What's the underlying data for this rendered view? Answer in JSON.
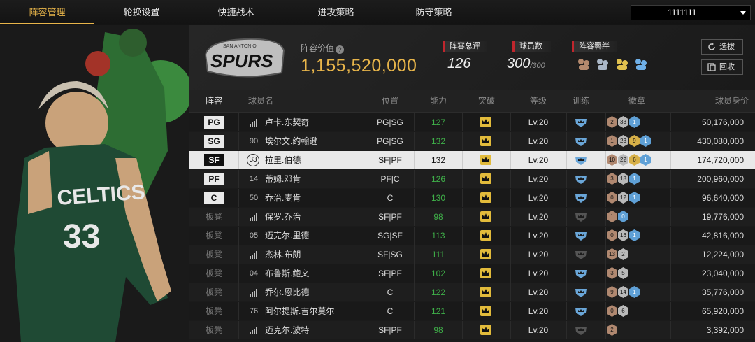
{
  "nav": {
    "tabs": [
      "阵容管理",
      "轮换设置",
      "快捷战术",
      "进攻策略",
      "防守策略"
    ],
    "active_tab": 0,
    "user_select": "1111111"
  },
  "header": {
    "cap_label": "阵容价值",
    "cap_value": "1,155,520,000",
    "overall_label": "阵容总评",
    "overall_value": "126",
    "count_label": "球员数",
    "count_value": "300",
    "count_max": "/300",
    "bond_label": "阵容羁绊",
    "logo_text": "SPURS",
    "logo_city": "SAN ANTONIO",
    "btn_select": "选拔",
    "btn_recycle": "回收"
  },
  "columns": [
    "阵容",
    "球员名",
    "位置",
    "能力",
    "突破",
    "等级",
    "训练",
    "徽章",
    "球员身价"
  ],
  "rows": [
    {
      "slot": "PG",
      "starter": true,
      "num": "",
      "name": "卢卡.东契奇",
      "pos": "PG|SG",
      "ability": "127",
      "level": "Lv.20",
      "train": "blue",
      "badges": [
        [
          "b-br",
          "2"
        ],
        [
          "b-si",
          "33"
        ],
        [
          "b-hf",
          "1"
        ]
      ],
      "value": "50,176,000"
    },
    {
      "slot": "SG",
      "starter": true,
      "num": "90",
      "name": "埃尔文.约翰逊",
      "pos": "PG|SG",
      "ability": "132",
      "level": "Lv.20",
      "train": "blue",
      "badges": [
        [
          "b-br",
          "1"
        ],
        [
          "b-si",
          "23"
        ],
        [
          "b-go",
          "9"
        ],
        [
          "b-hf",
          "1"
        ]
      ],
      "value": "430,080,000"
    },
    {
      "slot": "SF",
      "starter": true,
      "num": "33",
      "name": "拉里.伯德",
      "pos": "SF|PF",
      "ability": "132",
      "level": "Lv.20",
      "train": "blue",
      "badges": [
        [
          "b-br",
          "10"
        ],
        [
          "b-si",
          "22"
        ],
        [
          "b-go",
          "6"
        ],
        [
          "b-hf",
          "1"
        ]
      ],
      "value": "174,720,000",
      "selected": true
    },
    {
      "slot": "PF",
      "starter": true,
      "num": "14",
      "name": "蒂姆.邓肯",
      "pos": "PF|C",
      "ability": "126",
      "level": "Lv.20",
      "train": "blue",
      "badges": [
        [
          "b-br",
          "3"
        ],
        [
          "b-si",
          "18"
        ],
        [
          "b-hf",
          "1"
        ]
      ],
      "value": "200,960,000"
    },
    {
      "slot": "C",
      "starter": true,
      "num": "50",
      "name": "乔治.麦肯",
      "pos": "C",
      "ability": "130",
      "level": "Lv.20",
      "train": "blue",
      "badges": [
        [
          "b-br",
          "0"
        ],
        [
          "b-si",
          "12"
        ],
        [
          "b-hf",
          "1"
        ]
      ],
      "value": "96,640,000"
    },
    {
      "slot": "板凳",
      "starter": false,
      "num": "",
      "name": "保罗.乔治",
      "pos": "SF|PF",
      "ability": "98",
      "level": "Lv.20",
      "train": "grey",
      "badges": [
        [
          "b-br",
          "1"
        ],
        [
          "b-hf",
          "0"
        ]
      ],
      "value": "19,776,000"
    },
    {
      "slot": "板凳",
      "starter": false,
      "num": "05",
      "name": "迈克尔.里德",
      "pos": "SG|SF",
      "ability": "113",
      "level": "Lv.20",
      "train": "blue",
      "badges": [
        [
          "b-br",
          "0"
        ],
        [
          "b-si",
          "16"
        ],
        [
          "b-hf",
          "1"
        ]
      ],
      "value": "42,816,000"
    },
    {
      "slot": "板凳",
      "starter": false,
      "num": "",
      "name": "杰林.布朗",
      "pos": "SF|SG",
      "ability": "111",
      "level": "Lv.20",
      "train": "grey",
      "badges": [
        [
          "b-br",
          "13"
        ],
        [
          "b-si",
          "2"
        ]
      ],
      "value": "12,224,000"
    },
    {
      "slot": "板凳",
      "starter": false,
      "num": "04",
      "name": "布鲁斯.鲍文",
      "pos": "SF|PF",
      "ability": "102",
      "level": "Lv.20",
      "train": "blue",
      "badges": [
        [
          "b-br",
          "3"
        ],
        [
          "b-si",
          "5"
        ]
      ],
      "value": "23,040,000"
    },
    {
      "slot": "板凳",
      "starter": false,
      "num": "",
      "name": "乔尔.恩比德",
      "pos": "C",
      "ability": "122",
      "level": "Lv.20",
      "train": "blue",
      "badges": [
        [
          "b-br",
          "9"
        ],
        [
          "b-si",
          "14"
        ],
        [
          "b-hf",
          "1"
        ]
      ],
      "value": "35,776,000"
    },
    {
      "slot": "板凳",
      "starter": false,
      "num": "76",
      "name": "阿尔提斯.吉尔莫尔",
      "pos": "C",
      "ability": "121",
      "level": "Lv.20",
      "train": "blue",
      "badges": [
        [
          "b-br",
          "0"
        ],
        [
          "b-si",
          "6"
        ]
      ],
      "value": "65,920,000"
    },
    {
      "slot": "板凳",
      "starter": false,
      "num": "",
      "name": "迈克尔.波特",
      "pos": "SF|PF",
      "ability": "98",
      "level": "Lv.20",
      "train": "grey",
      "badges": [
        [
          "b-br",
          "2"
        ]
      ],
      "value": "3,392,000"
    }
  ],
  "colors": {
    "accent": "#e8b54a",
    "green": "#3fb049",
    "red": "#c0262d"
  }
}
